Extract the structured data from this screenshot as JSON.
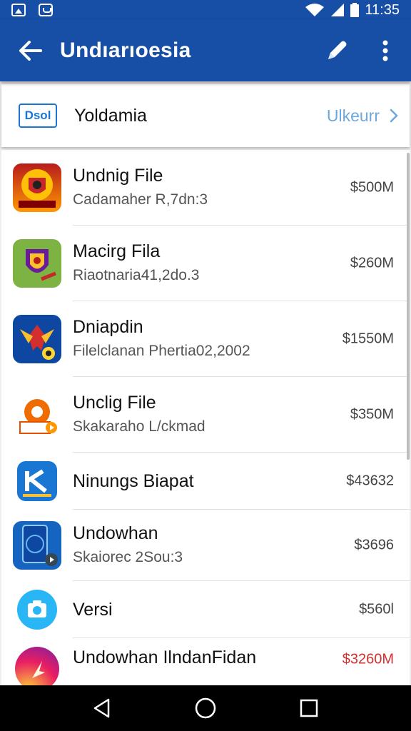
{
  "status": {
    "time": "11:35"
  },
  "app_bar": {
    "title": "Undıarıoesia"
  },
  "filter": {
    "badge": "Dsol",
    "title": "Yoldamia",
    "action": "Ulkeurr"
  },
  "items": [
    {
      "title": "Undnig File",
      "subtitle": "Cadamaher R,7dn:3",
      "size": "$500M",
      "icon": "sun-shield-app-icon"
    },
    {
      "title": "Macirg Fila",
      "subtitle": "Riaotnaria41,2do.3",
      "size": "$260M",
      "icon": "crest-app-icon"
    },
    {
      "title": "Dniapdin",
      "subtitle": "Filelclanan Phertia02,2002",
      "size": "$1550M",
      "icon": "eagle-app-icon"
    },
    {
      "title": "Unclig File",
      "subtitle": "Skakaraho L/ckmad",
      "size": "$350M",
      "icon": "gear-app-icon"
    },
    {
      "title": "Ninungs Biapat",
      "subtitle": "",
      "size": "$43632",
      "icon": "k-app-icon"
    },
    {
      "title": "Undowhan",
      "subtitle": "Skaiorec 2Sou:3",
      "size": "$3696",
      "icon": "phone-app-icon"
    },
    {
      "title": "Versi",
      "subtitle": "",
      "size": "$560l",
      "icon": "camera-app-icon"
    },
    {
      "title": "Undowhan IlndanFidan",
      "subtitle": "",
      "size": "$3260M",
      "icon": "instagram-app-icon",
      "size_color": "#d32f2f"
    }
  ],
  "colors": {
    "primary": "#174ea6",
    "accent": "#1976d2",
    "link": "#6fa8dc"
  }
}
